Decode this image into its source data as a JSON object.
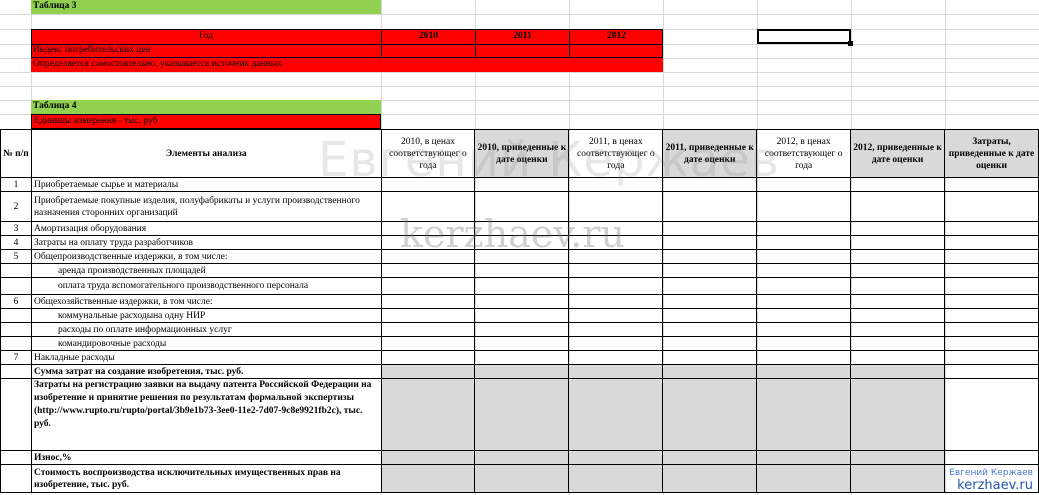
{
  "table3": {
    "caption": "Таблица 3",
    "header": [
      "Год",
      "2010",
      "2011",
      "2012"
    ],
    "row_label": "Индекс потребительских цен",
    "note": "Определяется самостоятельно, указывается источник данных"
  },
  "table4": {
    "caption": "Таблица 4",
    "units": "Единицы измерения - тыс. руб"
  },
  "columns": {
    "num": "№ п/п",
    "elements": "Элементы анализа",
    "c2010a": "2010, в ценах соответствующег о года",
    "c2010b": "2010, приведенные к дате оценки",
    "c2011a": "2011, в ценах соответствующег о года",
    "c2011b": "2011, приведенные к дате оценки",
    "c2012a": "2012, в ценах соответствующег о года",
    "c2012b": "2012, приведенные к дате оценки",
    "total": "Затраты, приведенные к дате оценки"
  },
  "rows": [
    {
      "num": "1",
      "label": "Приобретаемые сырье и материалы"
    },
    {
      "num": "2",
      "label": "Приобретаемые покупные изделия, полуфабрикаты и услуги производственного назначения сторонних организаций"
    },
    {
      "num": "3",
      "label": "Амортизация  оборудования"
    },
    {
      "num": "4",
      "label": "Затраты на оплату труда разработчиков"
    },
    {
      "num": "5",
      "label": "Общепроизводственные издержки, в том числе:"
    },
    {
      "num": "",
      "label": "аренда производственных площадей"
    },
    {
      "num": "",
      "label": "оплата труда вспомогательного производственного персонала"
    },
    {
      "num": "6",
      "label": "Общехозяйственные издержки, в том числе:"
    },
    {
      "num": "",
      "label": "коммунальные расходына одну НИР"
    },
    {
      "num": "",
      "label": "расходы по оплате информационных услуг"
    },
    {
      "num": "",
      "label": "командировочные расходы"
    },
    {
      "num": "7",
      "label": "Накладные расходы"
    }
  ],
  "summary": {
    "sum_label": "Сумма затрат на создание изобретения, тыс. руб.",
    "patent_label": "Затраты на регистрацию заявки на выдачу патента Российской Федерации на изобретение и принятие решения по результатам формальной экспертизы (http://www.rupto.ru/rupto/portal/3b9e1b73-3ee0-11e2-7d07-9c8e9921fb2c), тыс. руб.",
    "wear_label": "Износ,%",
    "cost_label": "Стоимость воспроизводства исключительных имущественных прав на изобретение, тыс. руб."
  },
  "watermark": {
    "main": "Евгений Кержаев",
    "site": "kerzhaev.ru",
    "badge_name": "Евгений Кержаев",
    "badge_site": "kerzhaev.ru"
  },
  "colors": {
    "green": "#92d050",
    "red": "#ff0000",
    "gray": "#d9d9d9"
  }
}
